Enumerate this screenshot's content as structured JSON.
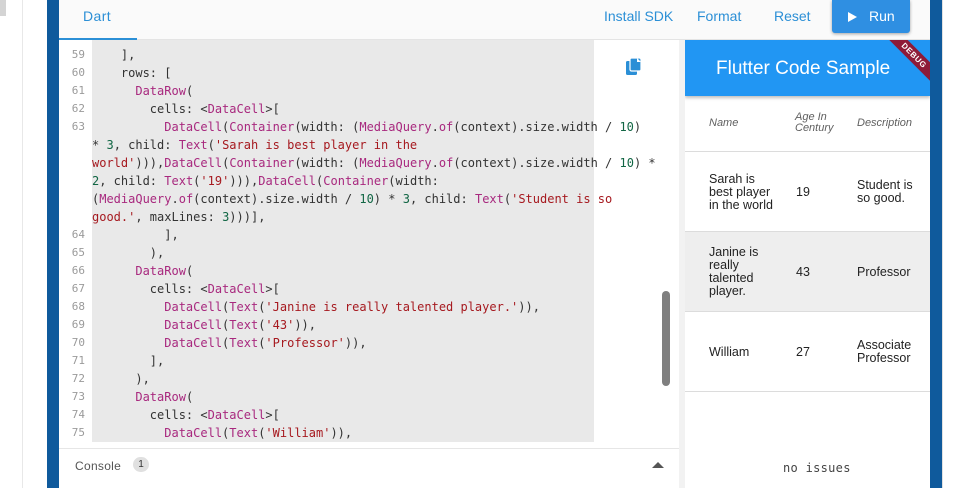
{
  "toolbar": {
    "tab_label": "Dart",
    "install_sdk": "Install SDK",
    "format": "Format",
    "reset": "Reset",
    "run": "Run"
  },
  "editor": {
    "line_numbers": [
      "59",
      "60",
      "61",
      "62",
      "63",
      "64",
      "65",
      "66",
      "67",
      "68",
      "69",
      "70",
      "71",
      "72",
      "73",
      "74",
      "75"
    ],
    "copy_icon": "copy-icon"
  },
  "console": {
    "label": "Console",
    "count": "1"
  },
  "preview": {
    "app_title": "Flutter Code Sample",
    "debug_banner": "DEBUG",
    "columns": [
      "Name",
      "Age In Century",
      "Description"
    ],
    "rows": [
      {
        "name": "Sarah is best player in the world",
        "age": "19",
        "description": "Student is so good."
      },
      {
        "name": "Janine is really talented player.",
        "age": "43",
        "description": "Professor"
      },
      {
        "name": "William",
        "age": "27",
        "description": "Associate Professor"
      }
    ]
  },
  "status": {
    "text": "no issues"
  },
  "colors": {
    "accent": "#2196f3",
    "run_button": "#2f8fe2",
    "frame": "#0f5a9c",
    "debug_banner": "#8e1a38",
    "code_type": "#a8287e",
    "code_string": "#a6191f",
    "code_number": "#116644"
  }
}
